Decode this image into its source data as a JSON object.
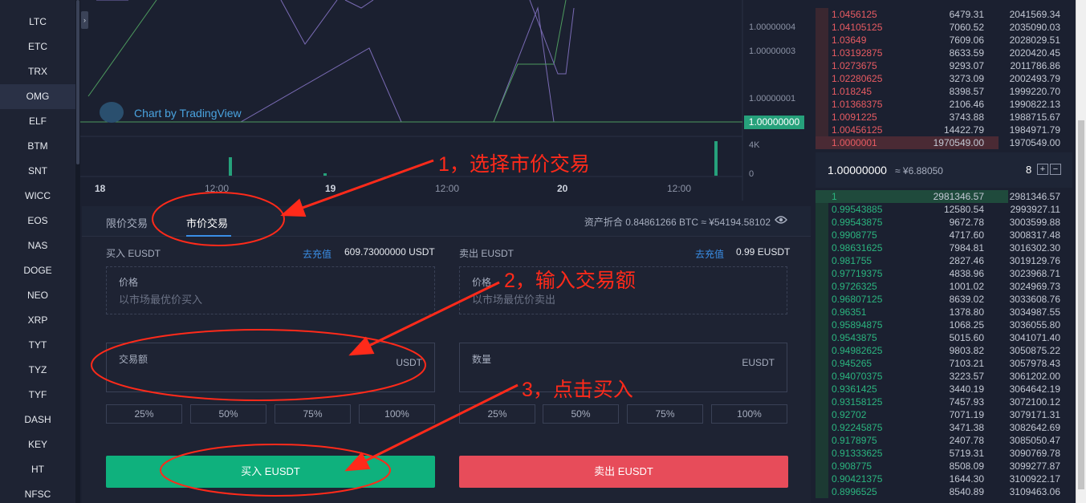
{
  "coins": [
    "LTC",
    "ETC",
    "TRX",
    "OMG",
    "ELF",
    "BTM",
    "SNT",
    "WICC",
    "EOS",
    "NAS",
    "DOGE",
    "NEO",
    "XRP",
    "TYT",
    "TYZ",
    "TYF",
    "DASH",
    "KEY",
    "HT",
    "NFSC"
  ],
  "active_coin_index": 3,
  "chart": {
    "price_labels": [
      "1.00000004",
      "1.00000003",
      "1.00000001"
    ],
    "last_price": "1.00000000",
    "volume_max_label": "4K",
    "volume_zero_label": "0",
    "time_labels": [
      "18",
      "12:00",
      "19",
      "12:00",
      "20",
      "12:00"
    ],
    "watermark": "Chart by TradingView"
  },
  "trade": {
    "tabs": [
      "限价交易",
      "市价交易"
    ],
    "active_tab_index": 1,
    "asset_summary": "资产折合 0.84861266 BTC ≈ ¥54194.58102",
    "buy": {
      "title": "买入 EUSDT",
      "deposit_link": "去充值",
      "balance": "609.73000000 USDT",
      "price_label": "价格",
      "price_placeholder": "以市场最优价买入",
      "amount_label": "交易额",
      "amount_unit": "USDT",
      "percent_buttons": [
        "25%",
        "50%",
        "75%",
        "100%"
      ],
      "button": "买入 EUSDT"
    },
    "sell": {
      "title": "卖出 EUSDT",
      "deposit_link": "去充值",
      "balance": "0.99 EUSDT",
      "price_label": "价格",
      "price_placeholder": "以市场最优价卖出",
      "amount_label": "数量",
      "amount_unit": "EUSDT",
      "percent_buttons": [
        "25%",
        "50%",
        "75%",
        "100%"
      ],
      "button": "卖出 EUSDT"
    }
  },
  "annotations": [
    "1，选择市价交易",
    "2，输入交易额",
    "3，点击买入"
  ],
  "orderbook": {
    "asks": [
      [
        "1.0456125",
        "6479.31",
        "2041569.34"
      ],
      [
        "1.04105125",
        "7060.52",
        "2035090.03"
      ],
      [
        "1.03649",
        "7609.06",
        "2028029.51"
      ],
      [
        "1.03192875",
        "8633.59",
        "2020420.45"
      ],
      [
        "1.0273675",
        "9293.07",
        "2011786.86"
      ],
      [
        "1.02280625",
        "3273.09",
        "2002493.79"
      ],
      [
        "1.018245",
        "8398.57",
        "1999220.70"
      ],
      [
        "1.01368375",
        "2106.46",
        "1990822.13"
      ],
      [
        "1.0091225",
        "3743.88",
        "1988715.67"
      ],
      [
        "1.00456125",
        "14422.79",
        "1984971.79"
      ],
      [
        "1.0000001",
        "1970549.00",
        "1970549.00"
      ]
    ],
    "mid_price": "1.00000000",
    "mid_cny": "≈ ¥6.88050",
    "depth": "8",
    "bids": [
      [
        "1",
        "2981346.57",
        "2981346.57"
      ],
      [
        "0.99543885",
        "12580.54",
        "2993927.11"
      ],
      [
        "0.99543875",
        "9672.78",
        "3003599.88"
      ],
      [
        "0.9908775",
        "4717.60",
        "3008317.48"
      ],
      [
        "0.98631625",
        "7984.81",
        "3016302.30"
      ],
      [
        "0.981755",
        "2827.46",
        "3019129.76"
      ],
      [
        "0.97719375",
        "4838.96",
        "3023968.71"
      ],
      [
        "0.9726325",
        "1001.02",
        "3024969.73"
      ],
      [
        "0.96807125",
        "8639.02",
        "3033608.76"
      ],
      [
        "0.96351",
        "1378.80",
        "3034987.55"
      ],
      [
        "0.95894875",
        "1068.25",
        "3036055.80"
      ],
      [
        "0.9543875",
        "5015.60",
        "3041071.40"
      ],
      [
        "0.94982625",
        "9803.82",
        "3050875.22"
      ],
      [
        "0.945265",
        "7103.21",
        "3057978.43"
      ],
      [
        "0.94070375",
        "3223.57",
        "3061202.00"
      ],
      [
        "0.9361425",
        "3440.19",
        "3064642.19"
      ],
      [
        "0.93158125",
        "7457.93",
        "3072100.12"
      ],
      [
        "0.92702",
        "7071.19",
        "3079171.31"
      ],
      [
        "0.92245875",
        "3471.38",
        "3082642.69"
      ],
      [
        "0.9178975",
        "2407.78",
        "3085050.47"
      ],
      [
        "0.91333625",
        "5719.31",
        "3090769.78"
      ],
      [
        "0.908775",
        "8508.09",
        "3099277.87"
      ],
      [
        "0.90421375",
        "1644.30",
        "3100922.17"
      ],
      [
        "0.8996525",
        "8540.89",
        "3109463.06"
      ]
    ]
  }
}
